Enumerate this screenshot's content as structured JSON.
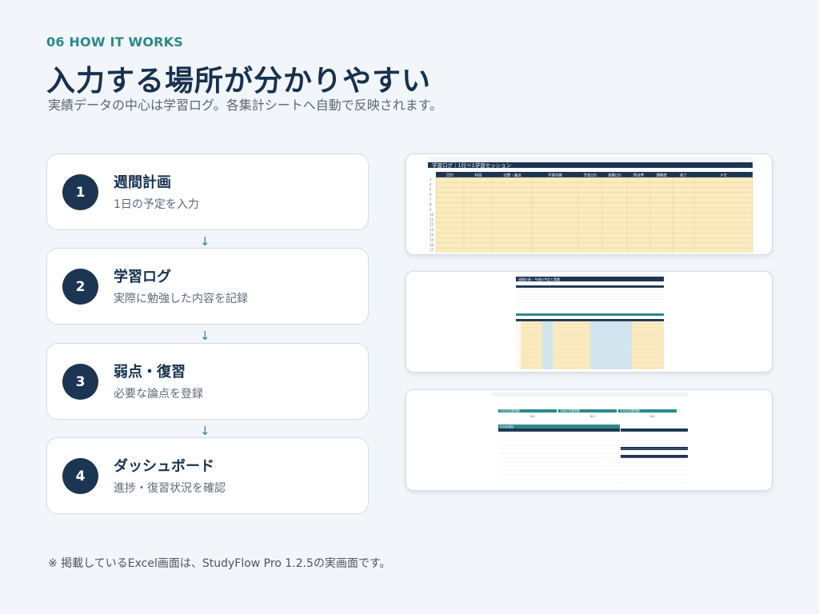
{
  "header": {
    "section_label": "06  HOW IT WORKS",
    "title": "入力する場所が分かりやすい",
    "subtitle": "実績データの中心は学習ログ。各集計シートへ自動で反映されます。"
  },
  "steps": [
    {
      "number": "1",
      "title": "週間計画",
      "description": "1日の予定を入力"
    },
    {
      "number": "2",
      "title": "学習ログ",
      "description": "実際に勉強した内容を記録"
    },
    {
      "number": "3",
      "title": "弱点・復習",
      "description": "必要な論点を登録"
    },
    {
      "number": "4",
      "title": "ダッシュボード",
      "description": "進捗・復習状況を確認"
    }
  ],
  "arrow_glyph": "↓",
  "screenshots": {
    "log": {
      "title": "学習ログ｜1行＝1学習セッション",
      "headers": [
        "日付",
        "科目",
        "分野・論点",
        "学習内容",
        "予定(分)",
        "実績(分)",
        "得点率",
        "理解度",
        "完了",
        "メモ"
      ]
    },
    "plan": {
      "title": "週間計画｜今週の予定と実績"
    },
    "dashboard": {
      "kpi_labels": [
        "今日の学習時間",
        "今週の学習時間",
        "今月の学習時間"
      ],
      "kpi_values": [
        "0.0",
        "0.0",
        "0.0"
      ],
      "table_title": "科目別進捗"
    }
  },
  "colors": {
    "navy": "#1c3553",
    "teal": "#2a8a88",
    "input_yellow": "#fbebbf",
    "input_blue": "#cfe6f5"
  },
  "footnote": "※ 掲載しているExcel画面は、StudyFlow Pro 1.2.5の実画面です。"
}
